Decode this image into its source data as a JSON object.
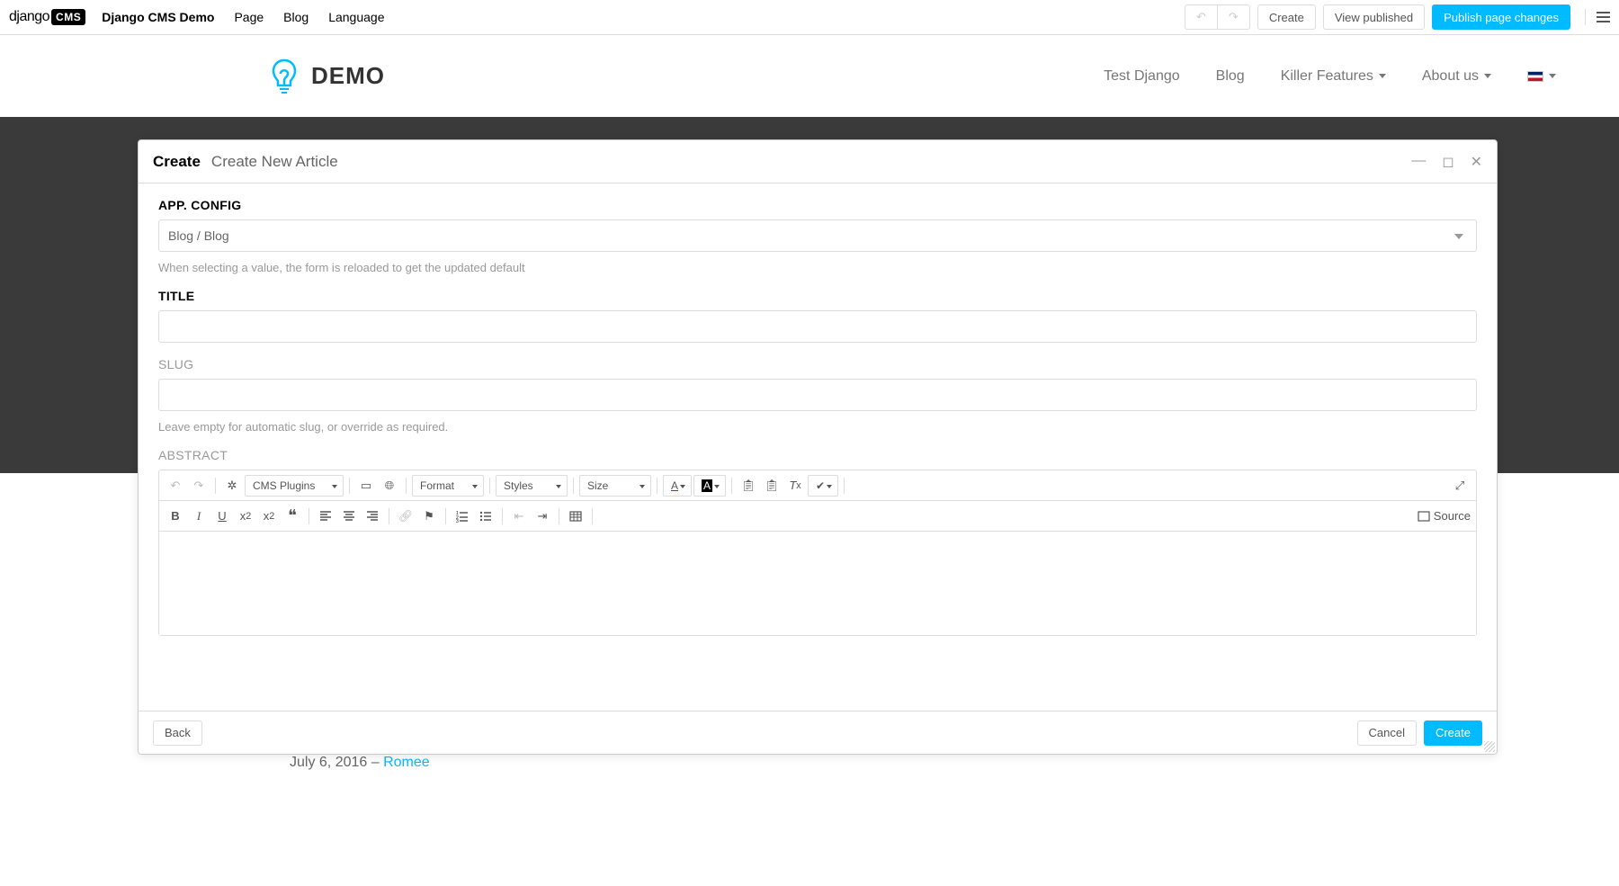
{
  "toolbar": {
    "logo_prefix": "django",
    "logo_badge": "CMS",
    "items": [
      "Django CMS Demo",
      "Page",
      "Blog",
      "Language"
    ],
    "undo_title": "Undo",
    "redo_title": "Redo",
    "create_label": "Create",
    "view_published_label": "View published",
    "publish_label": "Publish page changes"
  },
  "site": {
    "title": "DEMO",
    "nav": [
      {
        "label": "Test Django",
        "dd": false
      },
      {
        "label": "Blog",
        "dd": false
      },
      {
        "label": "Killer Features",
        "dd": true
      },
      {
        "label": "About us",
        "dd": true
      }
    ]
  },
  "modal": {
    "crumb": "Create",
    "sub": "Create New Article",
    "fields": {
      "app_config": {
        "label": "App. Config",
        "value": "Blog / Blog",
        "help": "When selecting a value, the form is reloaded to get the updated default"
      },
      "title": {
        "label": "Title",
        "value": ""
      },
      "slug": {
        "label": "Slug",
        "value": "",
        "help": "Leave empty for automatic slug, or override as required."
      },
      "abstract": {
        "label": "Abstract"
      }
    },
    "editor_dropdowns": {
      "cms_plugins": "CMS Plugins",
      "format": "Format",
      "styles": "Styles",
      "size": "Size"
    },
    "source_label": "Source",
    "footer": {
      "back": "Back",
      "cancel": "Cancel",
      "create": "Create"
    }
  },
  "leaked": {
    "date": "July 6, 2016",
    "sep": " – ",
    "author": "Romee"
  }
}
